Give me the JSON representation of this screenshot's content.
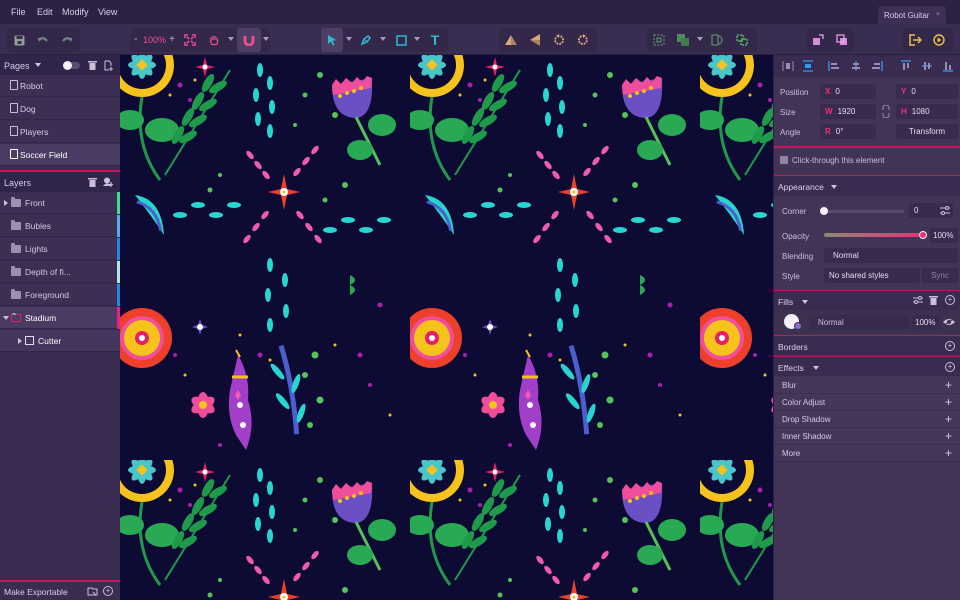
{
  "menubar": {
    "items": [
      "File",
      "Edit",
      "Modify",
      "View"
    ],
    "document_tab": "Robot Guitar",
    "close_glyph": "×"
  },
  "toolbar": {
    "zoom_level": "100%",
    "zoom_out": "-",
    "zoom_in": "+",
    "tools": [
      "save-icon",
      "undo-icon",
      "redo-icon",
      "fit-screen-icon",
      "hand-icon",
      "magnet-icon",
      "select-arrow-icon",
      "pen-icon",
      "rectangle-icon",
      "text-icon",
      "flip-horizontal-icon",
      "flip-vertical-icon",
      "rotate-left-icon",
      "rotate-right-icon",
      "group-select-icon",
      "boolean-icon",
      "mask-icon",
      "ungroup-icon",
      "bring-forward-icon",
      "send-backward-icon",
      "export-icon",
      "preview-play-icon"
    ],
    "text_tool_glyph": "T"
  },
  "pages": {
    "title": "Pages",
    "items": [
      {
        "label": "Robot",
        "selected": false
      },
      {
        "label": "Dog",
        "selected": false
      },
      {
        "label": "Players",
        "selected": false
      },
      {
        "label": "Soccer Field",
        "selected": true
      }
    ]
  },
  "layers": {
    "title": "Layers",
    "items": [
      {
        "label": "Front",
        "expandable": true,
        "color": "#3ddc97"
      },
      {
        "label": "Bubles",
        "expandable": false,
        "color": "#5aa9e6"
      },
      {
        "label": "Lights",
        "expandable": false,
        "color": "#1e88e5"
      },
      {
        "label": "Depth of fi...",
        "expandable": false,
        "color": "#b3e5e0"
      },
      {
        "label": "Foreground",
        "expandable": false,
        "color": "#1e88e5"
      },
      {
        "label": "Stadium",
        "expandable": true,
        "expanded": true,
        "selected": true,
        "color": "#e91e8c"
      },
      {
        "label": "Cutter",
        "expandable": true,
        "child": true
      }
    ]
  },
  "footer": {
    "make_exportable": "Make Exportable"
  },
  "inspector": {
    "position": {
      "label": "Position",
      "x_key": "X",
      "x": "0",
      "y_key": "Y",
      "y": "0"
    },
    "size": {
      "label": "Size",
      "w_key": "W",
      "w": "1920",
      "h_key": "H",
      "h": "1080"
    },
    "angle": {
      "label": "Angle",
      "r_key": "R",
      "r": "0°",
      "transform_button": "Transform"
    },
    "click_through": "Click-through this element",
    "appearance": {
      "title": "Appearance",
      "corner_label": "Corner",
      "corner_value": "0",
      "corner_slider": 0,
      "opacity_label": "Opacity",
      "opacity_value": "100%",
      "opacity_slider": 1.0,
      "blending_label": "Blending",
      "blending_value": "Normal",
      "style_label": "Style",
      "style_value": "No shared styles",
      "sync_button": "Sync"
    },
    "fills": {
      "title": "Fills",
      "blend": "Normal",
      "opacity": "100%"
    },
    "borders": {
      "title": "Borders"
    },
    "effects": {
      "title": "Effects",
      "items": [
        "Blur",
        "Color Adjust",
        "Drop Shadow",
        "Inner Shadow",
        "More"
      ],
      "add_glyph": "+"
    }
  },
  "colors": {
    "accent": "#c2185b",
    "accent_bright": "#ee2f78",
    "canvas_bg": "#0d0b33",
    "panel": "#3b2d51"
  }
}
